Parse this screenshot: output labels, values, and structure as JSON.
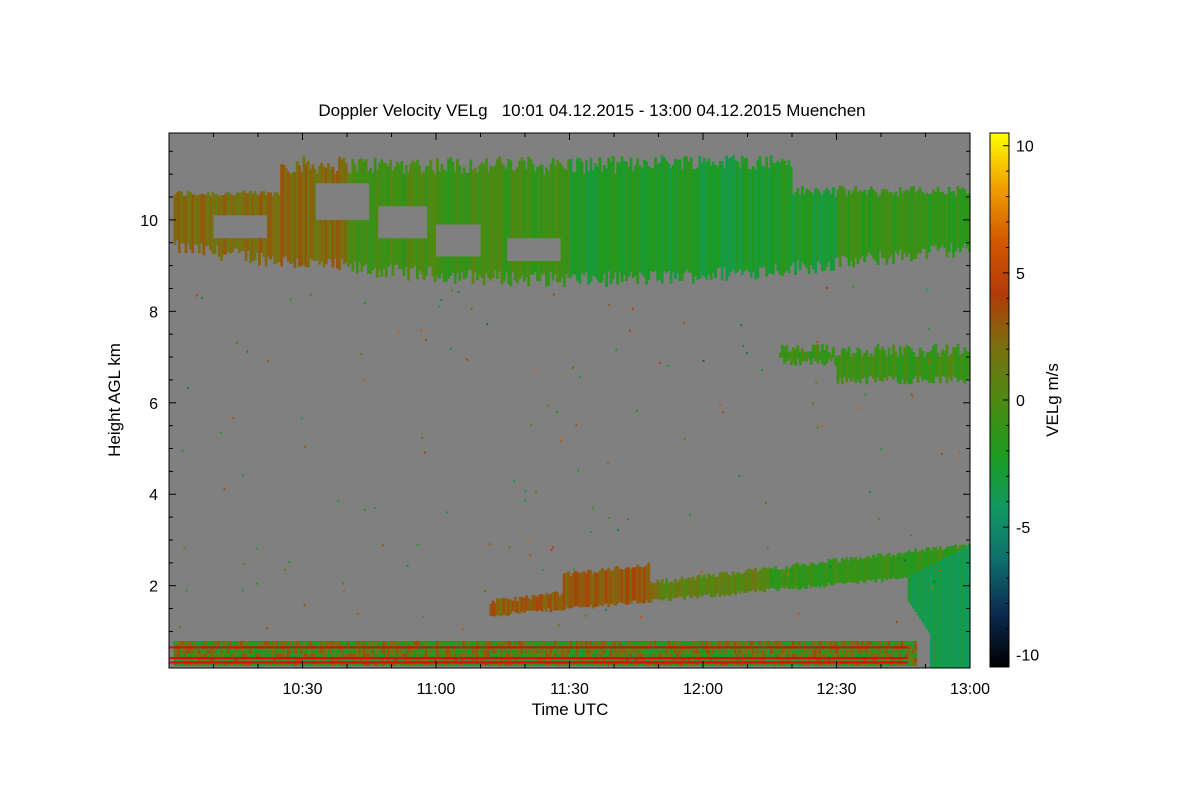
{
  "chart_data": {
    "type": "heatmap",
    "title": "Doppler Velocity VELg   10:01 04.12.2015 - 13:00 04.12.2015 Muenchen",
    "xlabel": "Time UTC",
    "ylabel": "Height AGL km",
    "colorbar_label": "VELg m/s",
    "x_range": [
      "10:01",
      "13:00"
    ],
    "y_range_km": [
      0.2,
      11.9
    ],
    "x_ticks": [
      {
        "label": "10:30",
        "minutes": 30
      },
      {
        "label": "11:00",
        "minutes": 60
      },
      {
        "label": "11:30",
        "minutes": 90
      },
      {
        "label": "12:00",
        "minutes": 120
      },
      {
        "label": "12:30",
        "minutes": 150
      },
      {
        "label": "13:00",
        "minutes": 180
      }
    ],
    "y_ticks": [
      {
        "label": "2",
        "km": 2
      },
      {
        "label": "4",
        "km": 4
      },
      {
        "label": "6",
        "km": 6
      },
      {
        "label": "8",
        "km": 8
      },
      {
        "label": "10",
        "km": 10
      }
    ],
    "colorbar": {
      "range": [
        -10.5,
        10.5
      ],
      "ticks": [
        {
          "label": "10",
          "value": 10
        },
        {
          "label": "5",
          "value": 5
        },
        {
          "label": "0",
          "value": 0
        },
        {
          "label": "-5",
          "value": -5
        },
        {
          "label": "-10",
          "value": -10
        }
      ],
      "colors": [
        "#000000",
        "#0b2a4e",
        "#0f6e6e",
        "#129a60",
        "#1e9a1e",
        "#4d8a12",
        "#7a6f10",
        "#b33a08",
        "#d45a00",
        "#f0a000",
        "#ffff00"
      ]
    },
    "background_color": "#808080",
    "regions": [
      {
        "name": "cirrus",
        "t_start": 1,
        "t_end": 180,
        "h_bottom_km": 8.5,
        "h_top_km": 11.5,
        "velocity_ms": -1.5
      },
      {
        "name": "mid-level layer",
        "t_start": 137,
        "t_end": 180,
        "h_bottom_km": 6.4,
        "h_top_km": 7.3,
        "velocity_ms": -1
      },
      {
        "name": "rising layer",
        "t_start": 72,
        "t_end": 180,
        "h_bottom_km": 1.3,
        "h_top_km": 2.9,
        "velocity_ms": 0.5
      },
      {
        "name": "boundary layer",
        "t_start": 1,
        "t_end": 180,
        "h_bottom_km": 0.25,
        "h_top_km": 0.75,
        "velocity_ms": 1.5
      },
      {
        "name": "precipitation",
        "t_start": 168,
        "t_end": 180,
        "h_bottom_km": 0.2,
        "h_top_km": 2.9,
        "velocity_ms": -3.5
      }
    ]
  }
}
